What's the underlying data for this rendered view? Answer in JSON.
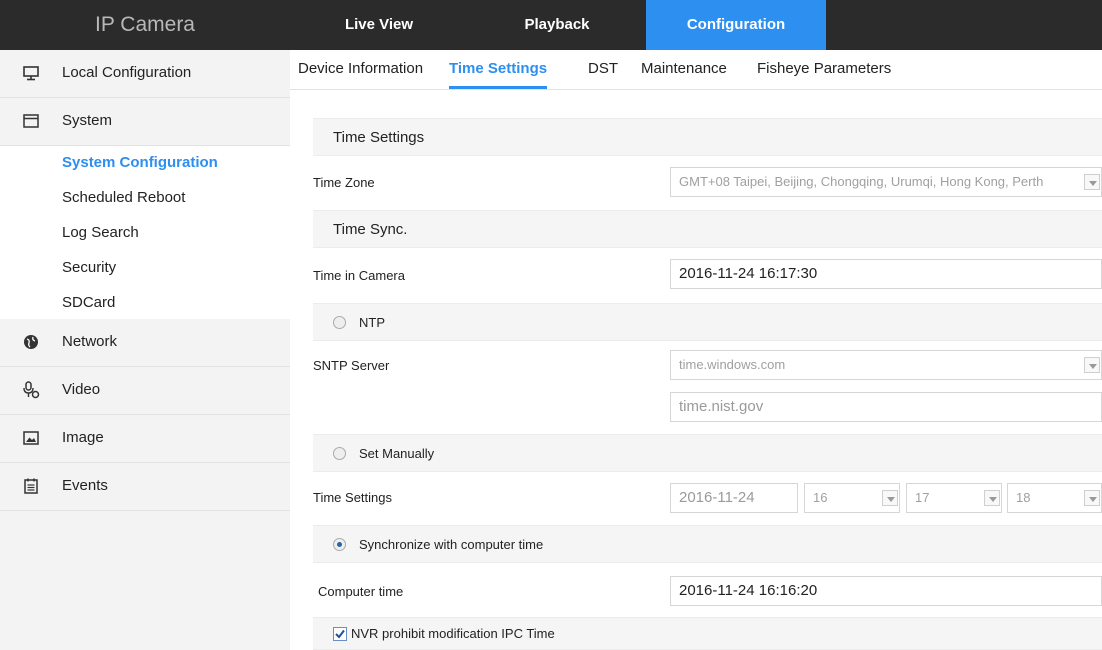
{
  "app": {
    "title": "IP Camera"
  },
  "topnav": [
    {
      "label": "Live View"
    },
    {
      "label": "Playback"
    },
    {
      "label": "Configuration",
      "active": true
    }
  ],
  "sidebar": {
    "items": [
      {
        "label": "Local Configuration",
        "icon": "monitor-icon"
      },
      {
        "label": "System",
        "icon": "window-icon"
      },
      {
        "label": "Network",
        "icon": "globe-icon"
      },
      {
        "label": "Video",
        "icon": "microphone-icon"
      },
      {
        "label": "Image",
        "icon": "image-icon"
      },
      {
        "label": "Events",
        "icon": "calendar-icon"
      }
    ],
    "system_sub": [
      {
        "label": "System Configuration",
        "active": true
      },
      {
        "label": "Scheduled Reboot"
      },
      {
        "label": "Log Search"
      },
      {
        "label": "Security"
      },
      {
        "label": "SDCard"
      }
    ]
  },
  "tabs": [
    {
      "label": "Device Information"
    },
    {
      "label": "Time Settings",
      "active": true
    },
    {
      "label": "DST"
    },
    {
      "label": "Maintenance"
    },
    {
      "label": "Fisheye Parameters"
    }
  ],
  "content": {
    "time_settings_header": "Time Settings",
    "time_zone_label": "Time Zone",
    "time_zone_value": "GMT+08 Taipei, Beijing, Chongqing, Urumqi, Hong Kong, Perth",
    "time_sync_header": "Time Sync.",
    "time_in_camera_label": "Time in Camera",
    "time_in_camera_value": "2016-11-24 16:17:30",
    "ntp_label": "NTP",
    "sntp_server_label": "SNTP Server",
    "sntp_server_value": "time.windows.com",
    "ntp_server_input": "time.nist.gov",
    "set_manually_label": "Set Manually",
    "manual_time_label": "Time Settings",
    "manual_date": "2016-11-24",
    "manual_hour": "16",
    "manual_minute": "17",
    "manual_second": "18",
    "sync_computer_label": "Synchronize with computer time",
    "computer_time_label": "Computer time",
    "computer_time_value": "2016-11-24 16:16:20",
    "nvr_prohibit_label": "NVR prohibit modification IPC Time",
    "nvr_prohibit_checked": true,
    "selected_sync_mode": "Synchronize with computer time"
  },
  "colors": {
    "accent": "#2d8ff0",
    "topbar": "#2b2b2b",
    "sidebar": "#f3f3f3"
  }
}
